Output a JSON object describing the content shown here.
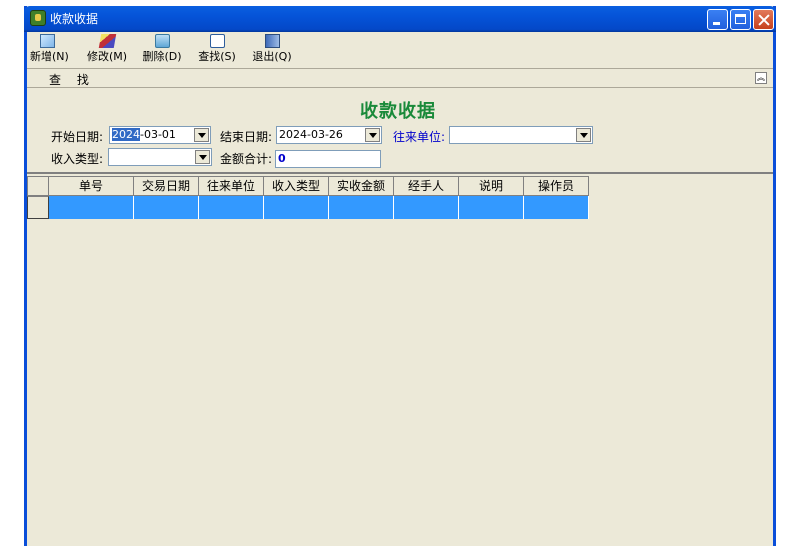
{
  "window": {
    "title": "收款收据"
  },
  "toolbar": [
    {
      "label": "新增(N)",
      "icon": "add-icon"
    },
    {
      "label": "修改(M)",
      "icon": "edit-icon"
    },
    {
      "label": "删除(D)",
      "icon": "delete-icon"
    },
    {
      "label": "查找(S)",
      "icon": "find-icon"
    },
    {
      "label": "退出(Q)",
      "icon": "exit-icon"
    }
  ],
  "findbar": {
    "label": "查 找"
  },
  "panel": {
    "title": "收款收据",
    "start_label": "开始日期:",
    "start_year": "2024",
    "start_rest": "-03-01",
    "end_label": "结束日期:",
    "end_value": "2024-03-26",
    "partner_label": "往来单位:",
    "partner_value": "",
    "type_label": "收入类型:",
    "type_value": "",
    "total_label": "金额合计:",
    "total_value": "0"
  },
  "grid": {
    "columns": [
      "单号",
      "交易日期",
      "往来单位",
      "收入类型",
      "实收金额",
      "经手人",
      "说明",
      "操作员"
    ],
    "rows": [
      [
        "",
        "",
        "",
        "",
        "",
        "",
        "",
        ""
      ]
    ]
  },
  "colors": {
    "title_green": "#1a8a3a",
    "selection": "#3399ff",
    "titlebar": "#0553d8"
  }
}
